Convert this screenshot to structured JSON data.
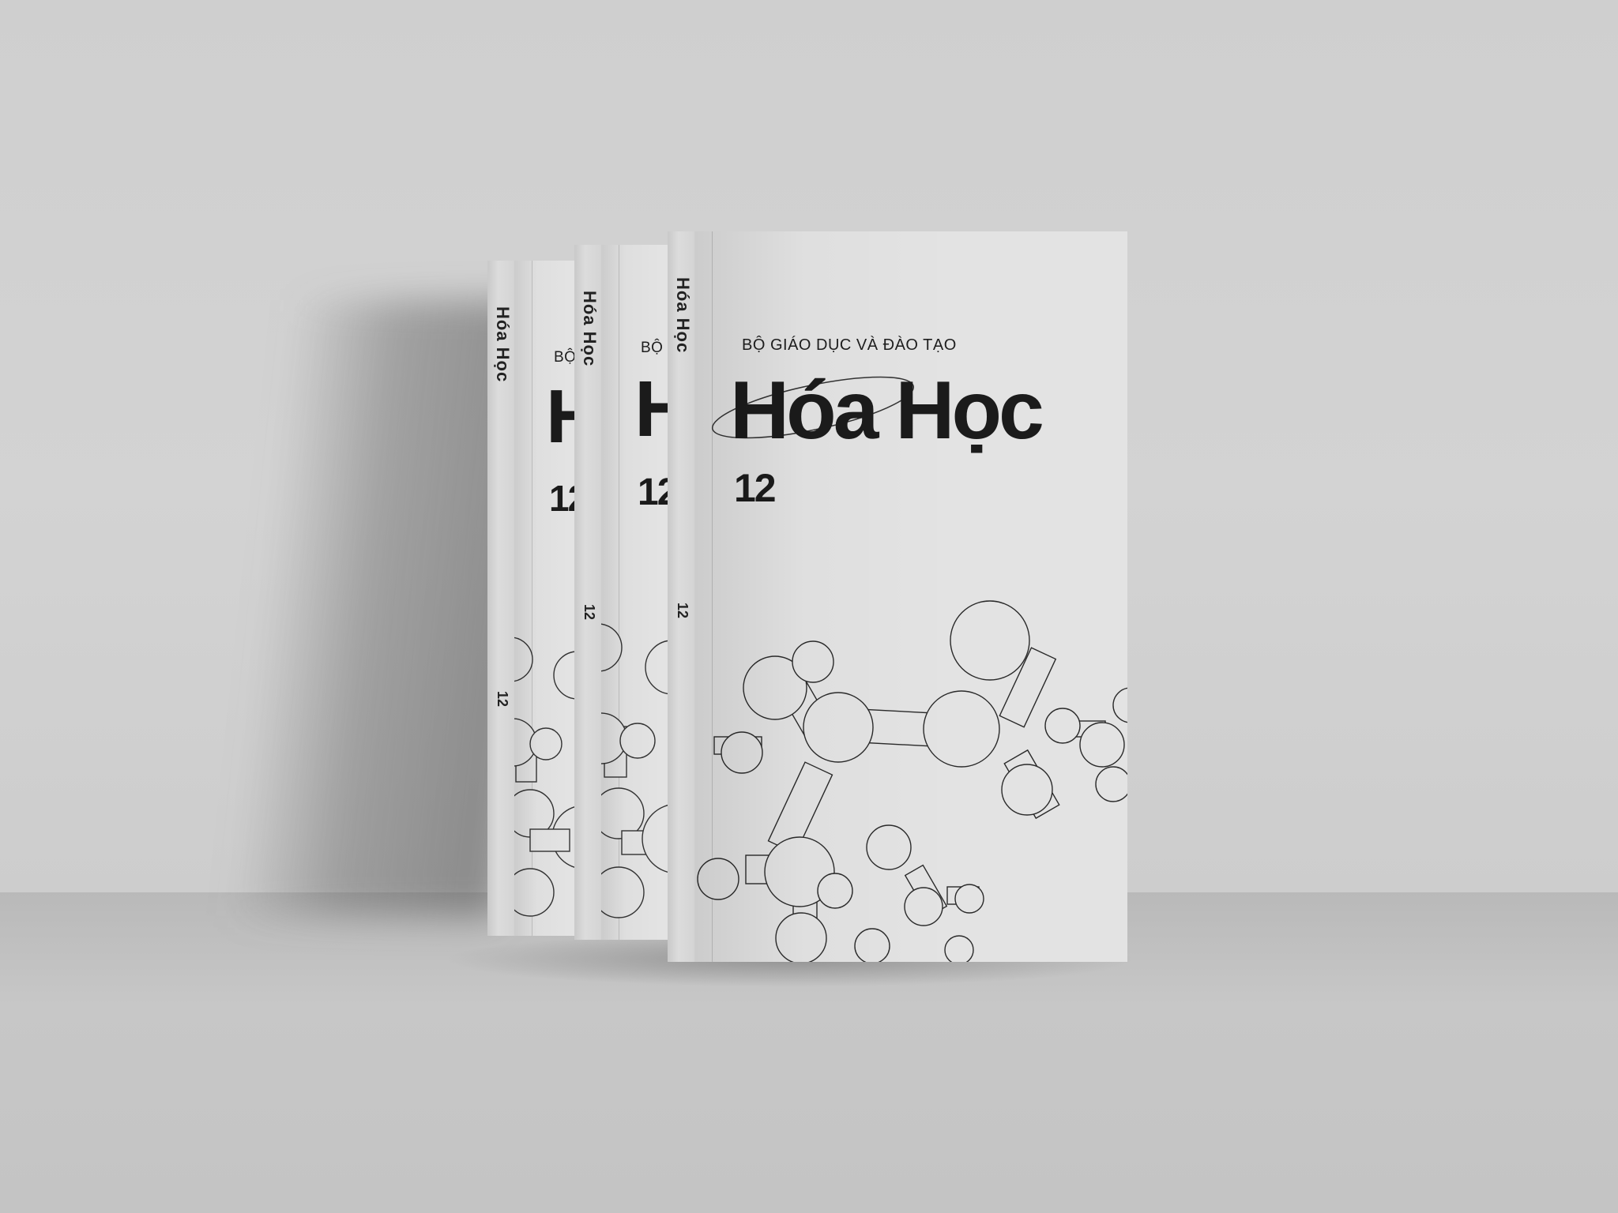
{
  "book": {
    "publisher": "BỘ GIÁO DỤC VÀ ĐÀO TẠO",
    "title": "Hóa Học",
    "grade": "12",
    "spine_title": "Hóa Học",
    "spine_grade": "12"
  },
  "back_books": [
    {
      "publisher_partial": "BỘ GI",
      "title_partial": "H",
      "grade": "12"
    },
    {
      "publisher_partial": "BỘ GI",
      "title_partial": "H",
      "grade": "12"
    }
  ],
  "colors": {
    "background": "#d0d0d0",
    "cover": "#e3e3e3",
    "ink": "#1b1b1b"
  }
}
